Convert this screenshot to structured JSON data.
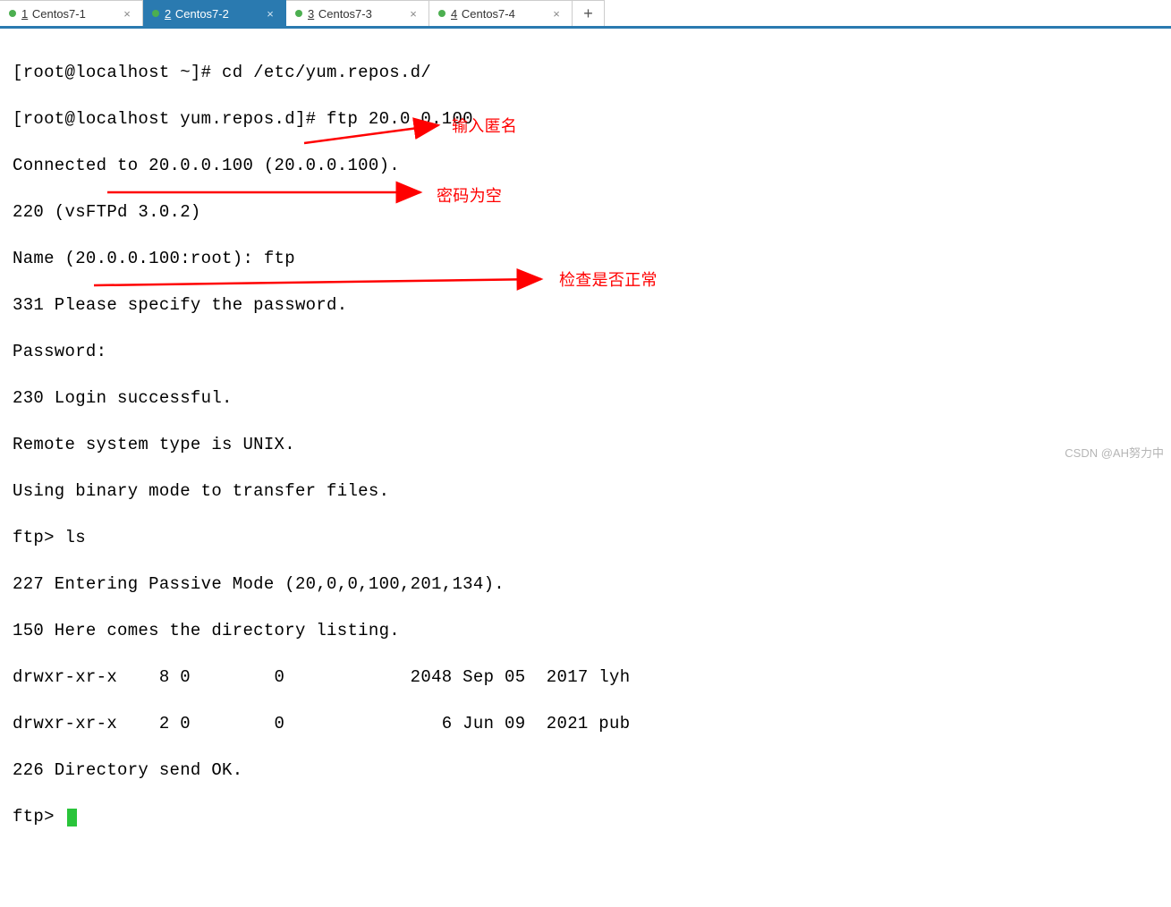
{
  "tabs": [
    {
      "num": "1",
      "label": "Centos7-1",
      "active": false
    },
    {
      "num": "2",
      "label": "Centos7-2",
      "active": true
    },
    {
      "num": "3",
      "label": "Centos7-3",
      "active": false
    },
    {
      "num": "4",
      "label": "Centos7-4",
      "active": false
    }
  ],
  "add_label": "+",
  "terminal": {
    "l0": "[root@localhost ~]# cd /etc/yum.repos.d/",
    "l1": "[root@localhost yum.repos.d]# ftp 20.0.0.100",
    "l2": "Connected to 20.0.0.100 (20.0.0.100).",
    "l3": "220 (vsFTPd 3.0.2)",
    "l4": "Name (20.0.0.100:root): ftp",
    "l5": "331 Please specify the password.",
    "l6": "Password:",
    "l7": "230 Login successful.",
    "l8": "Remote system type is UNIX.",
    "l9": "Using binary mode to transfer files.",
    "l10": "ftp> ls",
    "l11": "227 Entering Passive Mode (20,0,0,100,201,134).",
    "l12": "150 Here comes the directory listing.",
    "l13": "drwxr-xr-x    8 0        0            2048 Sep 05  2017 lyh",
    "l14": "drwxr-xr-x    2 0        0               6 Jun 09  2021 pub",
    "l15": "226 Directory send OK.",
    "l16": "ftp> "
  },
  "annotations": {
    "a1": "输入匿名",
    "a2": "密码为空",
    "a3": "检查是否正常"
  },
  "watermark": "CSDN @AH努力中",
  "arrow_color": "#ff0000"
}
